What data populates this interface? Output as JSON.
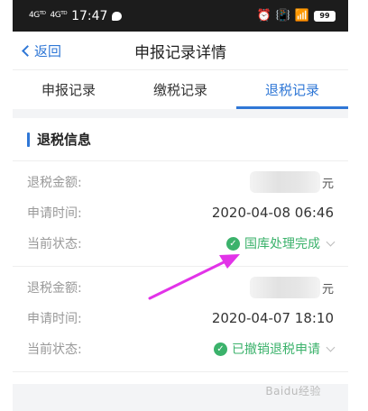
{
  "status_bar": {
    "signal1": "4Gᵀᴰ",
    "signal2": "4Gᵀᴰ",
    "time": "17:47",
    "battery": "99"
  },
  "nav": {
    "back_label": "返回",
    "title": "申报记录详情"
  },
  "tabs": [
    {
      "label": "申报记录",
      "active": false
    },
    {
      "label": "缴税记录",
      "active": false
    },
    {
      "label": "退税记录",
      "active": true
    }
  ],
  "section": {
    "title": "退税信息"
  },
  "records": [
    {
      "amount_label": "退税金额:",
      "amount_unit": "元",
      "time_label": "申请时间:",
      "time_value": "2020-04-08 06:46",
      "status_label": "当前状态:",
      "status_value": "国库处理完成"
    },
    {
      "amount_label": "退税金额:",
      "amount_unit": "元",
      "time_label": "申请时间:",
      "time_value": "2020-04-07 18:10",
      "status_label": "当前状态:",
      "status_value": "已撤销退税申请"
    }
  ],
  "watermark": "Baidu经验",
  "colors": {
    "accent": "#2f77d6",
    "success": "#3bb26b",
    "annotation_arrow": "#e233e8"
  }
}
